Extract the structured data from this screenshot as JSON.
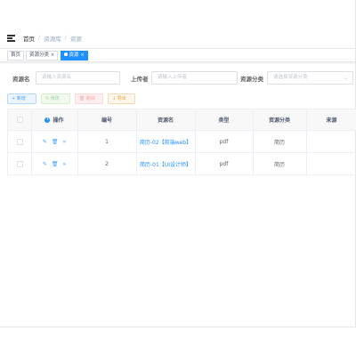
{
  "breadcrumb": [
    "首页",
    "资源库",
    "资源"
  ],
  "tags": [
    {
      "label": "首页",
      "active": false,
      "closable": false
    },
    {
      "label": "资源分类",
      "active": false,
      "closable": true
    },
    {
      "label": "资源",
      "active": true,
      "closable": true
    }
  ],
  "search": {
    "name_label": "资源名",
    "name_placeholder": "请输入资源名",
    "uploader_label": "上传者",
    "uploader_placeholder": "请输入上传者",
    "category_label": "资源分类",
    "category_placeholder": "请选择资源分类"
  },
  "toolbar": {
    "add": "+ 新增",
    "edit": "✎ 修改",
    "delete": "🗑 删除",
    "export": "↓ 导出"
  },
  "table": {
    "columns": [
      "操作",
      "编号",
      "资源名",
      "类型",
      "资源分类",
      "来源"
    ],
    "rows": [
      {
        "actions": [
          "✎",
          "🗑",
          "»"
        ],
        "id": "1",
        "name": "简历-02【前端web】",
        "type": "pdf",
        "category": "简历",
        "source": ""
      },
      {
        "actions": [
          "✎",
          "🗑",
          "»"
        ],
        "id": "2",
        "name": "简历-01【UI设计师】",
        "type": "pdf",
        "category": "简历",
        "source": ""
      }
    ]
  },
  "colors": {
    "primary": "#1e90ff",
    "header_bg": "#f8f8f9",
    "border": "#ebeef5"
  }
}
